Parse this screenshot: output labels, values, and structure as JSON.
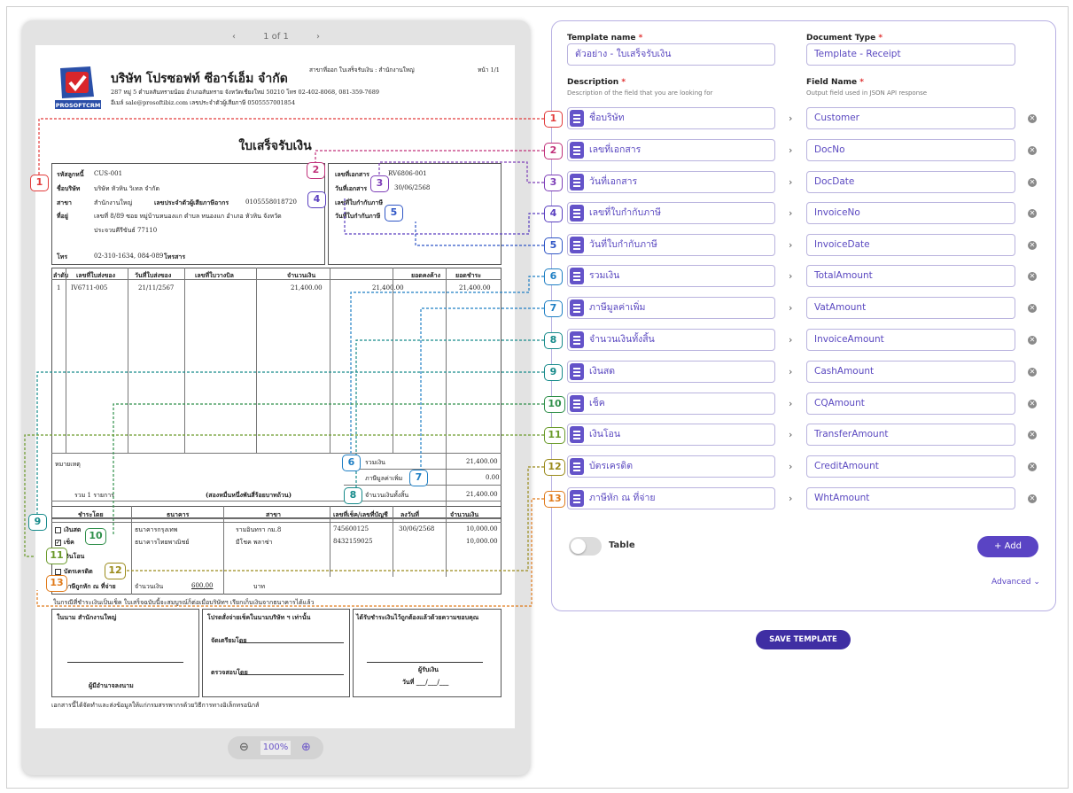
{
  "viewer": {
    "prev_icon": "chevron-left-icon",
    "page_indicator": "1 of 1",
    "next_icon": "chevron-right-icon",
    "zoom_out_icon": "zoom-out-icon",
    "zoom_level": "100%",
    "zoom_in_icon": "zoom-in-icon"
  },
  "document": {
    "logo_text": "PROSOFTCRM",
    "company_name": "บริษัท โปรซอฟท์ ซีอาร์เอ็ม จำกัด",
    "address": "287 หมู่ 5 ตำบลสันทรายน้อย อำเภอสันทราย จังหวัดเชียงใหม่ 50210 โทร 02-402-8068, 081-359-7689",
    "contact": "อีเมล์ sale@prosoftibiz.com เลขประจำตัวผู้เสียภาษี 0505557001854",
    "branch": "สาขาที่ออก ใบเสร็จรับเงิน : สำนักงานใหญ่",
    "page": "หน้า 1/1",
    "title": "ใบเสร็จรับเงิน",
    "customer_code_label": "รหัสลูกหนี้",
    "customer_code": "CUS-001",
    "customer_name_label": "ชื่อบริษัท",
    "customer_name": "บริษัท หัวหิน วิเทล จำกัด",
    "branch_label": "สาขา",
    "branch_value": "สำนักงานใหญ่",
    "tax_id_label": "เลขประจำตัวผู้เสียภาษีอากร",
    "tax_id": "0105558018720",
    "address_label": "ที่อยู่",
    "address_line1": "เลขที่ 8/89 ซอย หมู่บ้านหนองแก ตำบล หนองแก อำเภอ หัวหิน จังหวัด",
    "address_line2": "ประจวบคีรีขันธ์ 77110",
    "phone_label": "โทร",
    "phone": "02-310-1634, 084-089",
    "fax_label": "โทรสาร",
    "doc_no_label": "เลขที่เอกสาร",
    "doc_no": "RV6806-001",
    "doc_date_label": "วันที่เอกสาร",
    "doc_date": "30/06/2568",
    "invoice_no_label": "เลขที่ใบกำกับภาษี",
    "invoice_date_label": "วันที่ใบกำกับภาษี",
    "table_headers": [
      "ลำดับ",
      "เลขที่ใบส่งของ",
      "วันที่ใบส่งของ",
      "เลขที่ใบวางบิล",
      "จำนวนเงิน",
      "ยอดคงค้าง",
      "ยอดชำระ"
    ],
    "row": [
      "1",
      "IV6711-005",
      "21/11/2567",
      "",
      "21,400.00",
      "21,400.00",
      "21,400.00"
    ],
    "remark_label": "หมายเหตุ",
    "total_label": "รวมเงิน",
    "total": "21,400.00",
    "vat_label": "ภาษีมูลค่าเพิ่ม",
    "vat": "0.00",
    "grand_label": "จำนวนเงินทั้งสิ้น",
    "grand": "21,400.00",
    "item_count": "รวม 1 รายการ",
    "amount_words": "(สองหมื่นหนึ่งพันสี่ร้อยบาทถ้วน)",
    "pay_headers": [
      "ชำระโดย",
      "ธนาคาร",
      "สาขา",
      "เลขที่เช็ค/เลขที่บัญชี",
      "ลงวันที่",
      "จำนวนเงิน"
    ],
    "pay_cash": "เงินสด",
    "pay_cheque": "เช็ค",
    "pay_transfer": "เงินโอน",
    "pay_credit": "บัตรเครดิต",
    "pay_wht": "ภาษีถูกหัก ณ ที่จ่าย",
    "pay_row1": [
      "ธนาคารกรุงเทพ",
      "รามอินทรา กม.8",
      "745600125",
      "30/06/2568",
      "10,000.00"
    ],
    "pay_row2": [
      "ธนาคารไทยพาณิชย์",
      "มีโชค พลาซ่า",
      "8432159025",
      "",
      "10,000.00"
    ],
    "wht_amount_label": "จำนวนเงิน",
    "wht_amount": "600.00",
    "wht_unit": "บาท",
    "note": "ในกรณีที่ชำระเงินเป็นเช็ค ใบเสร็จฉบับนี้จะสมบูรณ์ก็ต่อเมื่อบริษัทฯ เรียกเก็บเงินจากธนาคารได้แล้ว",
    "sig1_title": "ในนาม สำนักงานใหญ่",
    "sig1_role": "ผู้มีอำนาจลงนาม",
    "sig2_title": "โปรดสั่งจ่ายเช็คในนามบริษัท ฯ เท่านั้น",
    "sig2_prepared": "จัดเตรียมโดย",
    "sig2_checked": "ตรวจสอบโดย",
    "sig3_title": "ได้รับชำระเงินไว้ถูกต้องแล้วด้วยความขอบคุณ",
    "sig3_receiver": "ผู้รับเงิน",
    "sig3_date": "วันที่ ___/___/___",
    "footer": "เอกสารนี้ได้จัดทำและส่งข้อมูลให้แก่กรมสรรพากรด้วยวิธีการทางอิเล็กทรอนิกส์"
  },
  "form": {
    "template_name_label": "Template name",
    "template_name_value": "ตัวอย่าง - ใบเสร็จรับเงิน",
    "doc_type_label": "Document Type",
    "doc_type_value": "Template - Receipt",
    "required_mark": "*",
    "description_label": "Description",
    "description_help": "Description of the field that you are looking for",
    "field_name_label": "Field Name",
    "field_name_help": "Output field used in JSON API response",
    "arrow_glyph": "›",
    "remove_glyph": "✕",
    "fields": [
      {
        "desc": "ชื่อบริษัท",
        "name": "Customer"
      },
      {
        "desc": "เลขที่เอกสาร",
        "name": "DocNo"
      },
      {
        "desc": "วันที่เอกสาร",
        "name": "DocDate"
      },
      {
        "desc": "เลขที่ใบกำกับภาษี",
        "name": "InvoiceNo"
      },
      {
        "desc": "วันที่ใบกำกับภาษี",
        "name": "InvoiceDate"
      },
      {
        "desc": "รวมเงิน",
        "name": "TotalAmount"
      },
      {
        "desc": "ภาษีมูลค่าเพิ่ม",
        "name": "VatAmount"
      },
      {
        "desc": "จำนวนเงินทั้งสิ้น",
        "name": "InvoiceAmount"
      },
      {
        "desc": "เงินสด",
        "name": "CashAmount"
      },
      {
        "desc": "เช็ค",
        "name": "CQAmount"
      },
      {
        "desc": "เงินโอน",
        "name": "TransferAmount"
      },
      {
        "desc": "บัตรเครดิต",
        "name": "CreditAmount"
      },
      {
        "desc": "ภาษีหัก ณ ที่จ่าย",
        "name": "WhtAmount"
      }
    ],
    "table_toggle_label": "Table",
    "add_button": "+ Add",
    "advanced_link": "Advanced",
    "save_button": "SAVE TEMPLATE"
  },
  "badges": [
    "1",
    "2",
    "3",
    "4",
    "5",
    "6",
    "7",
    "8",
    "9",
    "10",
    "11",
    "12",
    "13"
  ],
  "colors": {
    "accent": "#5a44c4",
    "badge_red": "#e23b3b",
    "badge_magenta": "#c0307a",
    "badge_purple": "#7e3fb8",
    "badge_indigo": "#5a3fc0",
    "badge_blue": "#2f56c6",
    "badge_sky": "#1f7fc4",
    "badge_teal": "#168a8a",
    "badge_green": "#2f8f4a",
    "badge_lime": "#6a9a2a",
    "badge_olive": "#9a8a1a",
    "badge_orange": "#e07a1a"
  }
}
